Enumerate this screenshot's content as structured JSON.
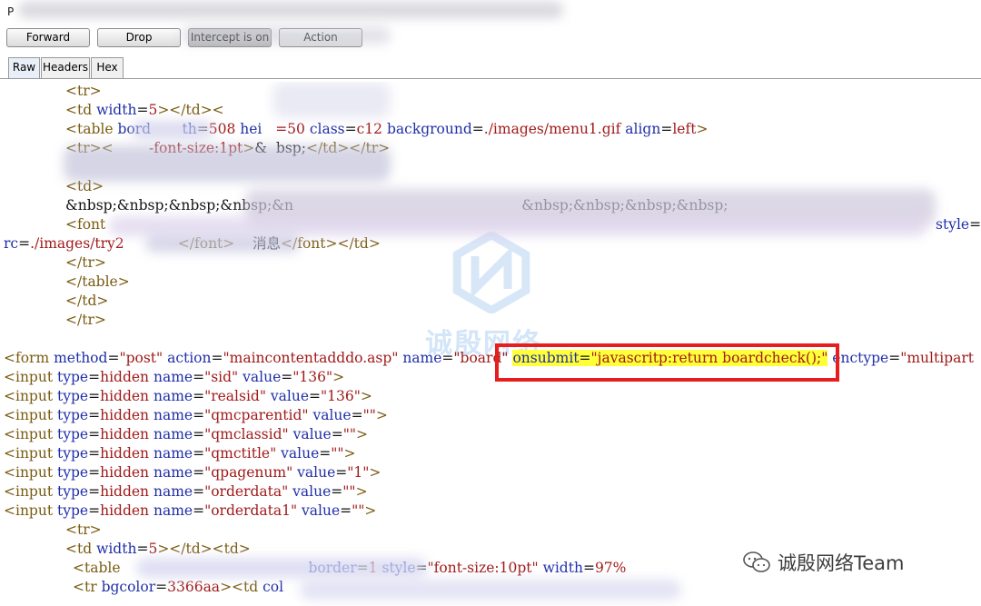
{
  "window": {
    "title_fragment": "P"
  },
  "toolbar": {
    "forward_label": "Forward",
    "drop_label": "Drop",
    "intercept_label": "Intercept is on",
    "action_label": "Action"
  },
  "tabs": [
    {
      "label": "Raw",
      "active": true
    },
    {
      "label": "Headers",
      "active": false
    },
    {
      "label": "Hex",
      "active": false
    }
  ],
  "editor": {
    "lines": [
      "<tr>",
      "<td width=5></td><",
      "<table bord    ...th=508 hei...t=50 class=c12 background=./images/menu1.gif align=left>",
      "<tr><   ...-font-size:1pt>&  bsp;</td></tr>",
      "",
      "<td>",
      "&nbsp;&nbsp;&nbsp;&nbsp;&n  ...  &nbsp;&nbsp;&nbsp;&nbsp;",
      "<font",
      "style=",
      "rc=./images/try2  ...  </font>   消息</font></td>",
      "</tr>",
      "</table>",
      "</td>",
      "</tr>",
      "",
      "<form method=\"post\" action=\"maincontentadddo.asp\" name=\"board\" onsubmit=\"javascritp:return boardcheck();\" enctype=\"multipart",
      "<input type=hidden name=\"sid\" value=\"136\">",
      "<input type=hidden name=\"realsid\" value=\"136\">",
      "<input type=hidden name=\"qmcparentid\" value=\"\">",
      "<input type=hidden name=\"qmclassid\" value=\"\">",
      "<input type=hidden name=\"qmctitle\" value=\"\">",
      "<input type=hidden name=\"qpagenum\" value=\"1\">",
      "<input type=hidden name=\"orderdata\" value=\"\">",
      "<input type=hidden name=\"orderdata1\" value=\"\">",
      "<tr>",
      "<td width=5></td><td>",
      "<table   ...   border=1 style=\"font-size:10pt\" width=97%   ...   ...bordercol",
      "<tr bgcolor=3366aa><td col"
    ],
    "highlighted_attribute": "onsubmit=\"javascritp:return boardcheck();\""
  },
  "watermark": {
    "center_text": "诚殷网络",
    "corner_text": "诚殷网络Team"
  },
  "colors": {
    "tag": "#7a5c12",
    "attribute": "#1f2fa8",
    "value": "#a11a1a",
    "highlight": "#ffff3a",
    "annotation_box": "#e81d1d"
  }
}
